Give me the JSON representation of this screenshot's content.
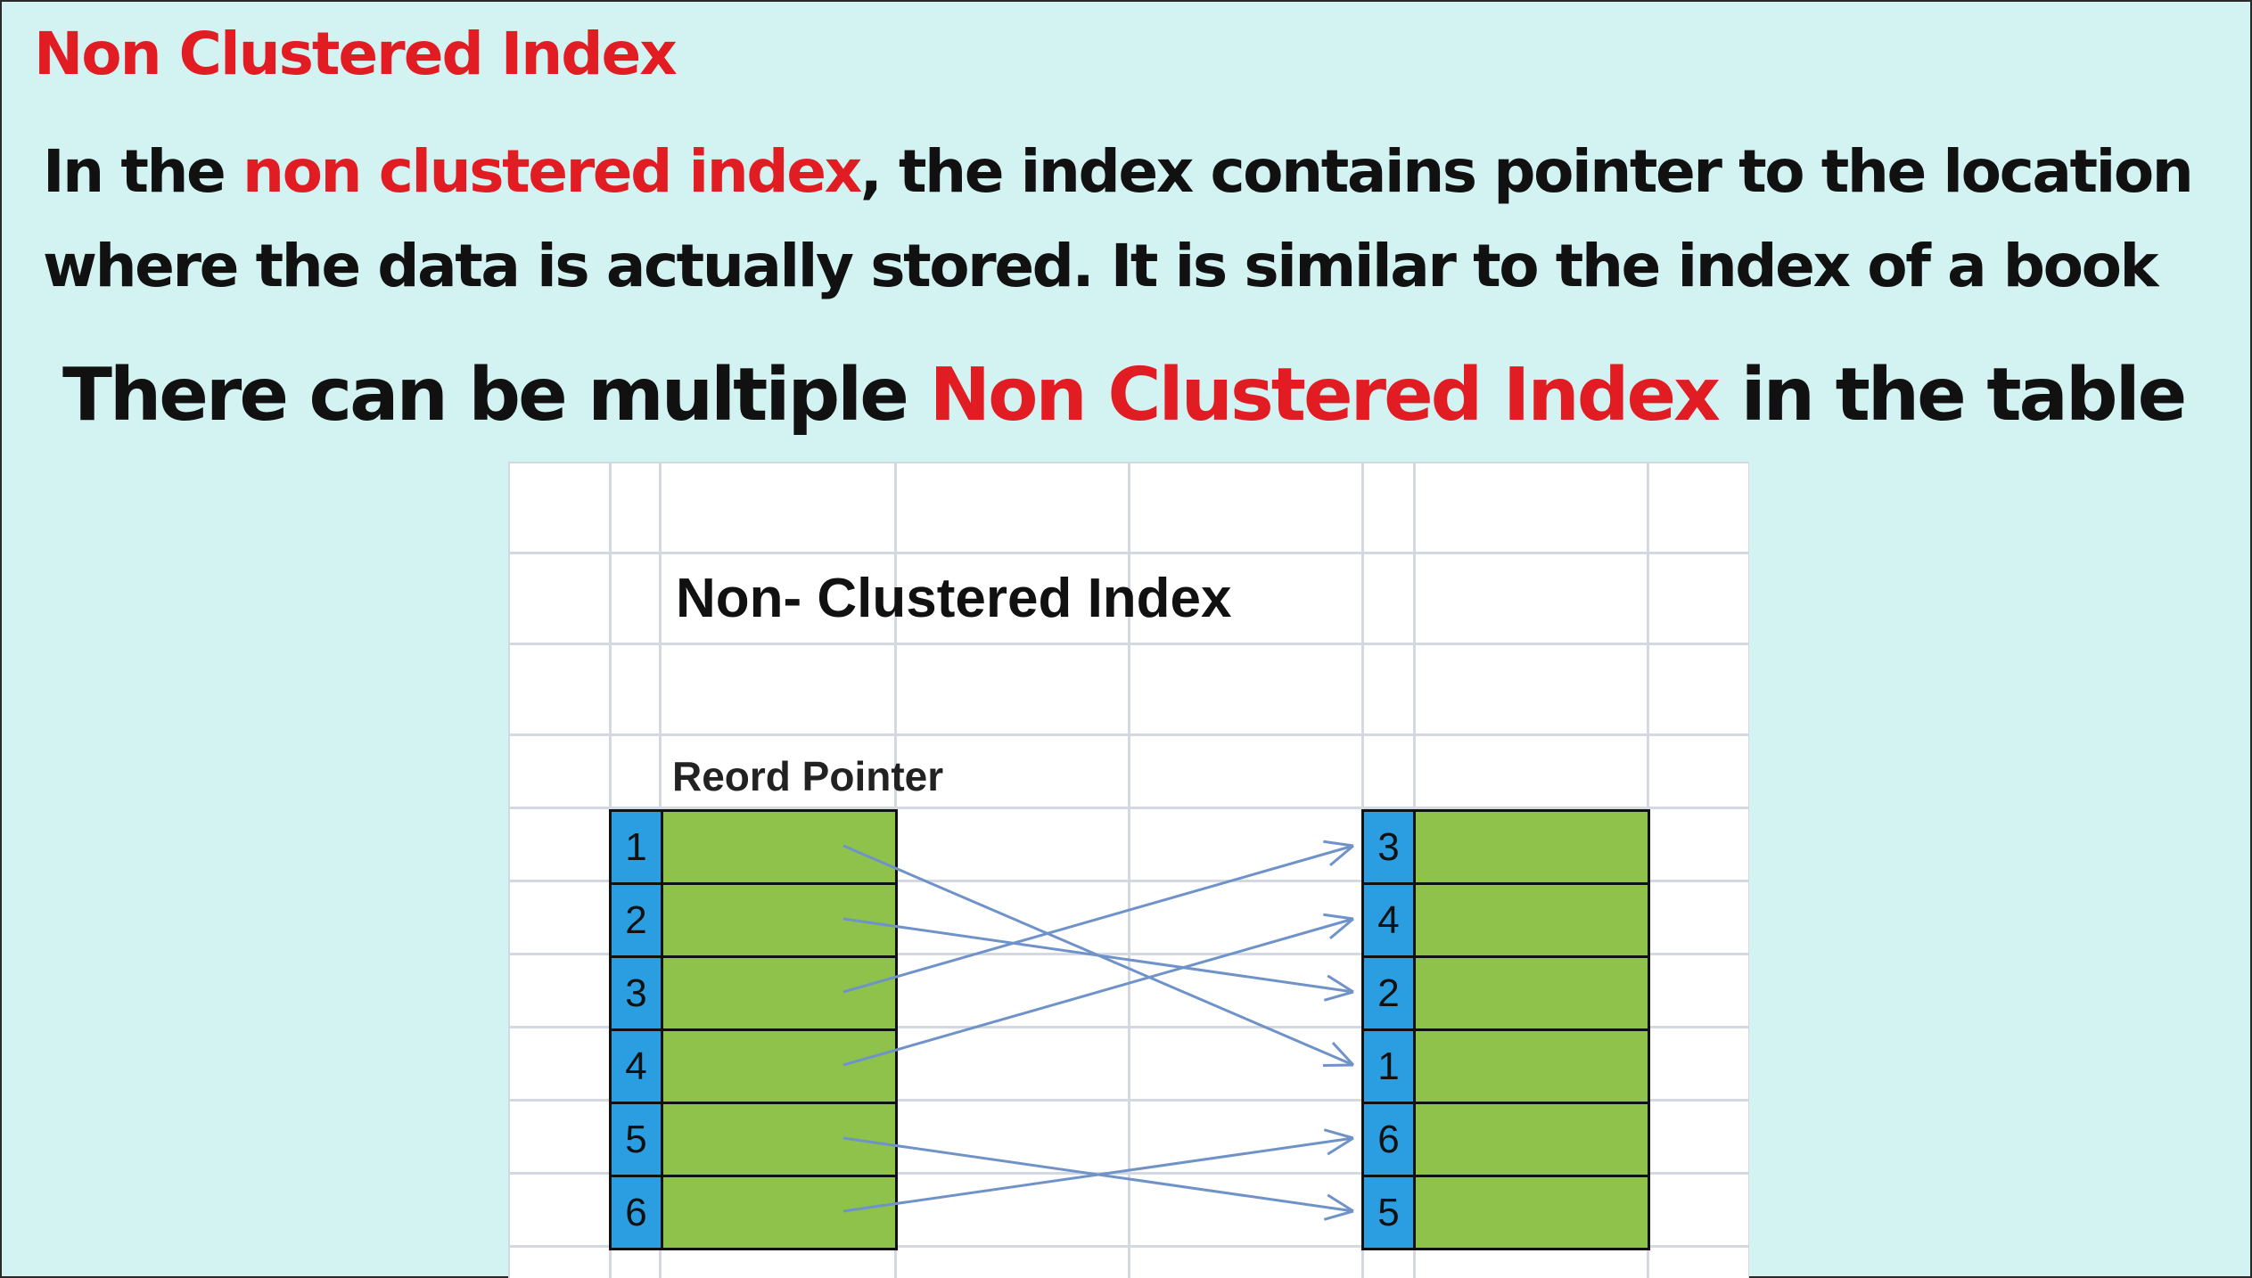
{
  "heading": "Non Clustered Index",
  "paragraph": {
    "intro": "In the ",
    "highlight": "non clustered index",
    "rest": ", the index contains pointer to the location where the data is actually stored. It is similar to the index of a book"
  },
  "note": {
    "before": "There can be multiple ",
    "highlight": "Non Clustered Index",
    "after": " in the table"
  },
  "diagram": {
    "title": "Non- Clustered Index",
    "pointer_label": "Reord Pointer",
    "left_keys": [
      "1",
      "2",
      "3",
      "4",
      "5",
      "6"
    ],
    "right_keys": [
      "3",
      "4",
      "2",
      "1",
      "6",
      "5"
    ],
    "colors": {
      "key": "#2a9ee0",
      "record": "#8fc24a",
      "arrow": "#6f93c9"
    }
  }
}
